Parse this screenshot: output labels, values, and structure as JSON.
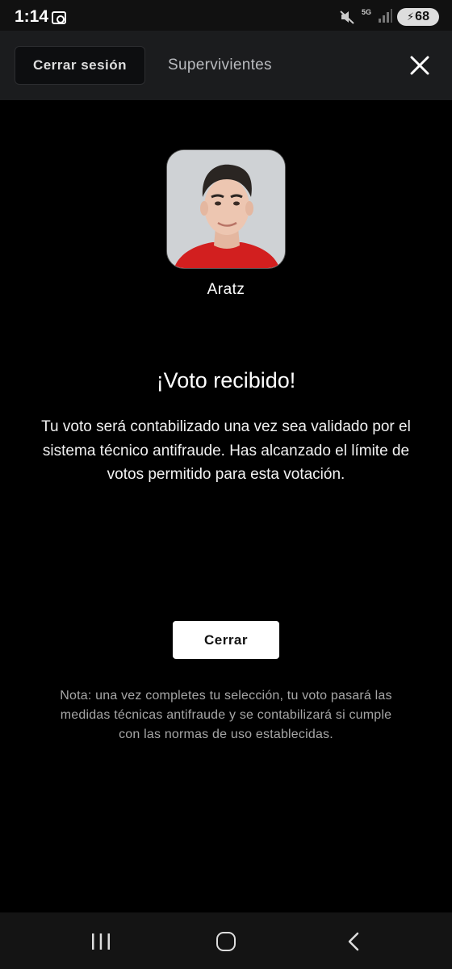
{
  "status_bar": {
    "time": "1:14",
    "network": "5G",
    "battery": "68",
    "icons": [
      "screen-record-icon",
      "mute-icon",
      "signal-icon",
      "battery-charging-icon"
    ]
  },
  "header": {
    "logout_label": "Cerrar sesión",
    "title": "Supervivientes",
    "close_icon": "close-icon"
  },
  "contestant": {
    "name": "Aratz"
  },
  "confirmation": {
    "title": "¡Voto recibido!",
    "message": "Tu voto será contabilizado una vez sea validado por el sistema técnico antifraude. Has alcanzado el límite de votos permitido para esta votación.",
    "close_label": "Cerrar",
    "note": "Nota: una vez completes tu selección, tu voto pasará las medidas técnicas antifraude y se contabilizará si cumple con las normas de uso establecidas."
  },
  "nav_bar": {
    "icons": [
      "recents-icon",
      "home-icon",
      "back-icon"
    ]
  },
  "colors": {
    "background": "#000000",
    "header_bg": "#1b1c1e",
    "button_bg": "#ffffff",
    "note_text": "#a6a6a6",
    "jersey": "#d21f1f"
  }
}
